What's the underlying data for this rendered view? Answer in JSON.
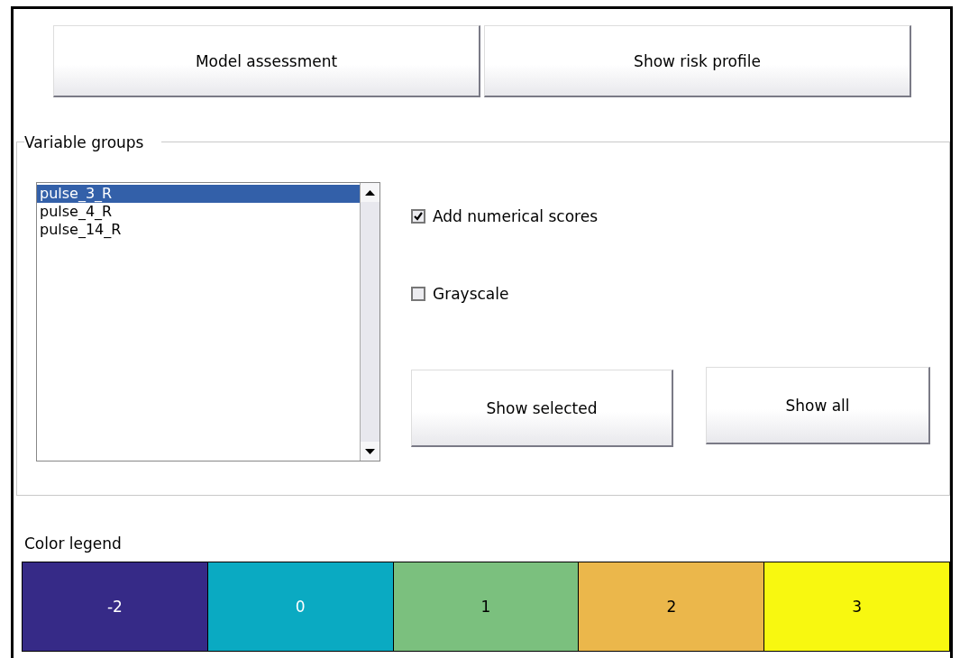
{
  "top_buttons": [
    "Model assessment",
    "Show risk profile"
  ],
  "variable_groups": {
    "title": "Variable groups",
    "items": [
      {
        "label": "pulse_3_R",
        "selected": true
      },
      {
        "label": "pulse_4_R",
        "selected": false
      },
      {
        "label": "pulse_14_R",
        "selected": false
      }
    ],
    "options": [
      {
        "label": "Add numerical scores",
        "checked": true
      },
      {
        "label": "Grayscale",
        "checked": false
      }
    ],
    "buttons": [
      "Show selected",
      "Show all"
    ]
  },
  "color_legend": {
    "title": "Color legend",
    "entries": [
      {
        "label": "-2",
        "color": "#362a87"
      },
      {
        "label": "0",
        "color": "#0aaac2"
      },
      {
        "label": "1",
        "color": "#7bc07e"
      },
      {
        "label": "2",
        "color": "#ebb74b"
      },
      {
        "label": "3",
        "color": "#f8f810"
      }
    ]
  }
}
